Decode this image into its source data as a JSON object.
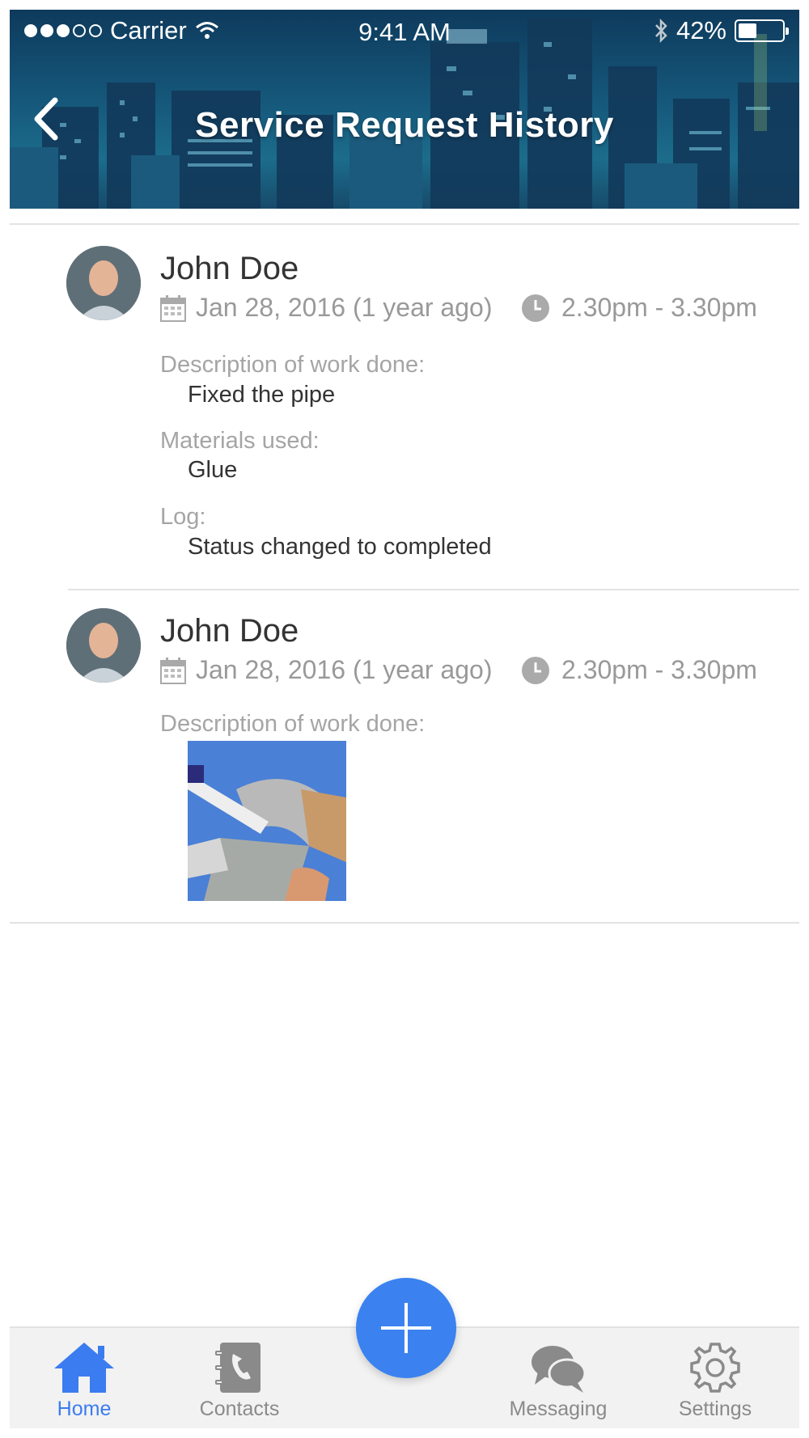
{
  "status_bar": {
    "carrier": "Carrier",
    "time": "9:41 AM",
    "battery": "42%",
    "battery_level": 0.42
  },
  "header": {
    "title": "Service Request History"
  },
  "entries": [
    {
      "name": "John Doe",
      "date": "Jan 28, 2016 (1 year ago)",
      "time": "2.30pm - 3.30pm",
      "fields": [
        {
          "label": "Description of work done:",
          "value": "Fixed the pipe"
        },
        {
          "label": "Materials used:",
          "value": "Glue"
        },
        {
          "label": "Log:",
          "value": "Status changed to  completed"
        }
      ]
    },
    {
      "name": "John Doe",
      "date": "Jan 28, 2016 (1 year ago)",
      "time": "2.30pm - 3.30pm",
      "fields": [
        {
          "label": "Description of work done:"
        }
      ]
    }
  ],
  "tabbar": {
    "tabs": [
      {
        "label": "Home",
        "icon": "home-icon",
        "active": true
      },
      {
        "label": "Contacts",
        "icon": "contacts-book-icon",
        "active": false
      },
      {
        "label": "Messaging",
        "icon": "chat-bubbles-icon",
        "active": false
      },
      {
        "label": "Settings",
        "icon": "gear-icon",
        "active": false
      }
    ],
    "fab_icon": "plus-icon"
  },
  "colors": {
    "accent": "#3b82f0",
    "tab_active": "#3b7cf0",
    "tab_inactive": "#8a8a8a",
    "label_gray": "#a5a5a5",
    "text_dark": "#333333"
  }
}
